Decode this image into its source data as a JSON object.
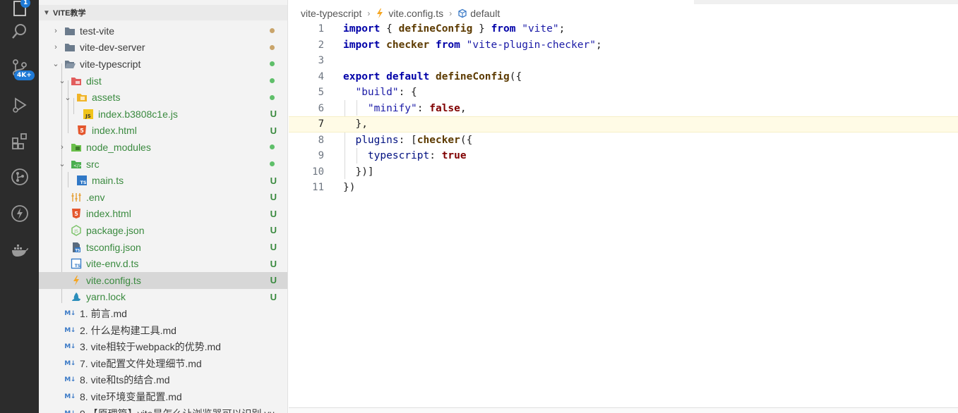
{
  "activity_bar": {
    "icons": [
      "files-icon",
      "search-icon",
      "source-control-icon",
      "run-debug-icon",
      "extensions-icon",
      "git-graph-icon",
      "thunder-icon",
      "docker-icon"
    ],
    "badges": {
      "files": "1",
      "source_control": "4K+"
    }
  },
  "explorer": {
    "title": "VITE教学",
    "items": [
      {
        "label": "test-vite",
        "type": "folder",
        "expanded": false,
        "status": "dot-tan"
      },
      {
        "label": "vite-dev-server",
        "type": "folder",
        "expanded": false,
        "status": "dot-tan"
      },
      {
        "label": "vite-typescript",
        "type": "folder",
        "expanded": true,
        "status": "dot-green"
      },
      {
        "label": "dist",
        "type": "folder-dist",
        "expanded": true,
        "status": "dot-green"
      },
      {
        "label": "assets",
        "type": "folder-assets",
        "expanded": true,
        "status": "dot-green"
      },
      {
        "label": "index.b3808c1e.js",
        "type": "js-file",
        "status": "U"
      },
      {
        "label": "index.html",
        "type": "html-file",
        "status": "U"
      },
      {
        "label": "node_modules",
        "type": "folder-node",
        "expanded": false,
        "status": "dot-green"
      },
      {
        "label": "src",
        "type": "folder-src",
        "expanded": true,
        "status": "dot-green"
      },
      {
        "label": "main.ts",
        "type": "ts-file",
        "status": "U"
      },
      {
        "label": ".env",
        "type": "env-file",
        "status": "U"
      },
      {
        "label": "index.html",
        "type": "html-file",
        "status": "U"
      },
      {
        "label": "package.json",
        "type": "node-file",
        "status": "U"
      },
      {
        "label": "tsconfig.json",
        "type": "tsconfig-file",
        "status": "U"
      },
      {
        "label": "vite-env.d.ts",
        "type": "ts-def-file",
        "status": "U"
      },
      {
        "label": "vite.config.ts",
        "type": "vite-file",
        "status": "U",
        "selected": true
      },
      {
        "label": "yarn.lock",
        "type": "yarn-file",
        "status": "U"
      },
      {
        "label": "1. 前言.md",
        "type": "md-file"
      },
      {
        "label": "2. 什么是构建工具.md",
        "type": "md-file"
      },
      {
        "label": "3. vite相较于webpack的优势.md",
        "type": "md-file"
      },
      {
        "label": "7. vite配置文件处理细节.md",
        "type": "md-file"
      },
      {
        "label": "8. vite和ts的结合.md",
        "type": "md-file"
      },
      {
        "label": "8. vite环境变量配置.md",
        "type": "md-file"
      },
      {
        "label": "9.【原理篇】vite是怎么让浏览器可以识别.vu",
        "type": "md-file"
      }
    ],
    "md_icon_text": "M↓"
  },
  "breadcrumb": {
    "folder": "vite-typescript",
    "file": "vite.config.ts",
    "symbol": "default"
  },
  "editor": {
    "current_line": 7,
    "lines": [
      {
        "n": "1"
      },
      {
        "n": "2"
      },
      {
        "n": "3"
      },
      {
        "n": "4"
      },
      {
        "n": "5"
      },
      {
        "n": "6"
      },
      {
        "n": "7"
      },
      {
        "n": "8"
      },
      {
        "n": "9"
      },
      {
        "n": "10"
      },
      {
        "n": "11"
      }
    ],
    "tokens": {
      "l1": [
        "import",
        " { ",
        "defineConfig",
        " } ",
        "from",
        " ",
        "\"vite\"",
        ";"
      ],
      "l2": [
        "import",
        " ",
        "checker",
        " ",
        "from",
        " ",
        "\"vite-plugin-checker\"",
        ";"
      ],
      "l4": [
        "export",
        " ",
        "default",
        " ",
        "defineConfig",
        "({"
      ],
      "l5": [
        "  ",
        "\"build\"",
        ": {"
      ],
      "l6": [
        "    ",
        "\"minify\"",
        ": ",
        "false",
        ","
      ],
      "l7": [
        "  ",
        "},"
      ],
      "l8": [
        "  ",
        "plugins",
        ": [",
        "checker",
        "({"
      ],
      "l9": [
        "    ",
        "typescript",
        ": ",
        "true"
      ],
      "l10": [
        "  ",
        "})]"
      ],
      "l11": [
        "})"
      ]
    }
  }
}
